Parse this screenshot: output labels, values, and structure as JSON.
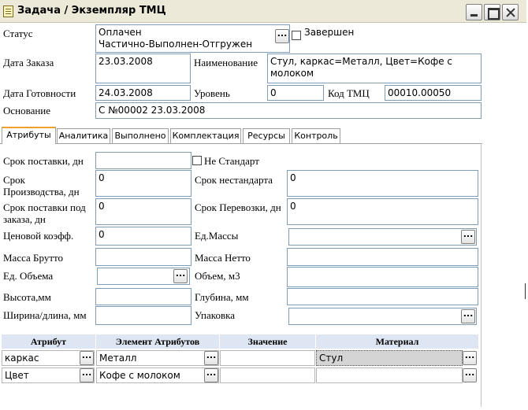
{
  "window": {
    "title": "Задача / Экземпляр ТМЦ"
  },
  "header": {
    "status_label": "Статус",
    "status_value_line1": "Оплачен",
    "status_value_line2": "Частично-Выполнен-Отгружен",
    "completed_label": "Завершен",
    "order_date_label": "Дата Заказа",
    "order_date_value": "23.03.2008",
    "name_label": "Наименование",
    "name_value": "Стул, каркас=Металл, Цвет=Кофе с молоком",
    "ready_date_label": "Дата Готовности",
    "ready_date_value": "24.03.2008",
    "level_label": "Уровень",
    "level_value": "0",
    "code_label": "Код ТМЦ",
    "code_value": "00010.00050",
    "basis_label": "Основание",
    "basis_value": "С №00002 23.03.2008"
  },
  "tabs": [
    {
      "label": "Атрибуты"
    },
    {
      "label": "Аналитика"
    },
    {
      "label": "Выполнено"
    },
    {
      "label": "Комплектация"
    },
    {
      "label": "Ресурсы"
    },
    {
      "label": "Контроль"
    }
  ],
  "attributes": {
    "delivery_term_label": "Срок поставки, дн",
    "delivery_term_value": "",
    "non_standard_label": "Не Стандарт",
    "production_term_label_1": "Срок",
    "production_term_label_2": "Производства, дн",
    "production_term_value": "0",
    "non_standard_term_label": "Срок нестандарта",
    "non_standard_term_value": "0",
    "delivery_order_label_1": "Срок поставки под",
    "delivery_order_label_2": "заказа, дн",
    "delivery_order_value": "0",
    "transport_term_label": "Срок Перевозки, дн",
    "transport_term_value": "0",
    "price_coef_label": "Ценовой коэфф.",
    "price_coef_value": "0",
    "mass_unit_label": "Ед.Массы",
    "mass_unit_value": "",
    "gross_label": "Масса Брутто",
    "gross_value": "",
    "net_label": "Масса Нетто",
    "net_value": "",
    "volume_unit_label": "Ед. Объема",
    "volume_unit_value": "",
    "volume_label": "Объем, м3",
    "volume_value": "",
    "height_label": "Высота,мм",
    "height_value": "",
    "depth_label": "Глубина, мм",
    "depth_value": "",
    "width_label": "Ширина/длина, мм",
    "width_value": "",
    "package_label": "Упаковка",
    "package_value": ""
  },
  "grid": {
    "columns": [
      "Атрибут",
      "Элемент Атрибутов",
      "Значение",
      "Материал"
    ],
    "rows": [
      {
        "attribute": "каркас",
        "element": "Металл",
        "value": "",
        "material": "Стул"
      },
      {
        "attribute": "Цвет",
        "element": "Кофе с молоком",
        "value": "",
        "material": ""
      }
    ]
  },
  "icons": {
    "ellipsis": "...",
    "doc_icon": "document-icon"
  }
}
